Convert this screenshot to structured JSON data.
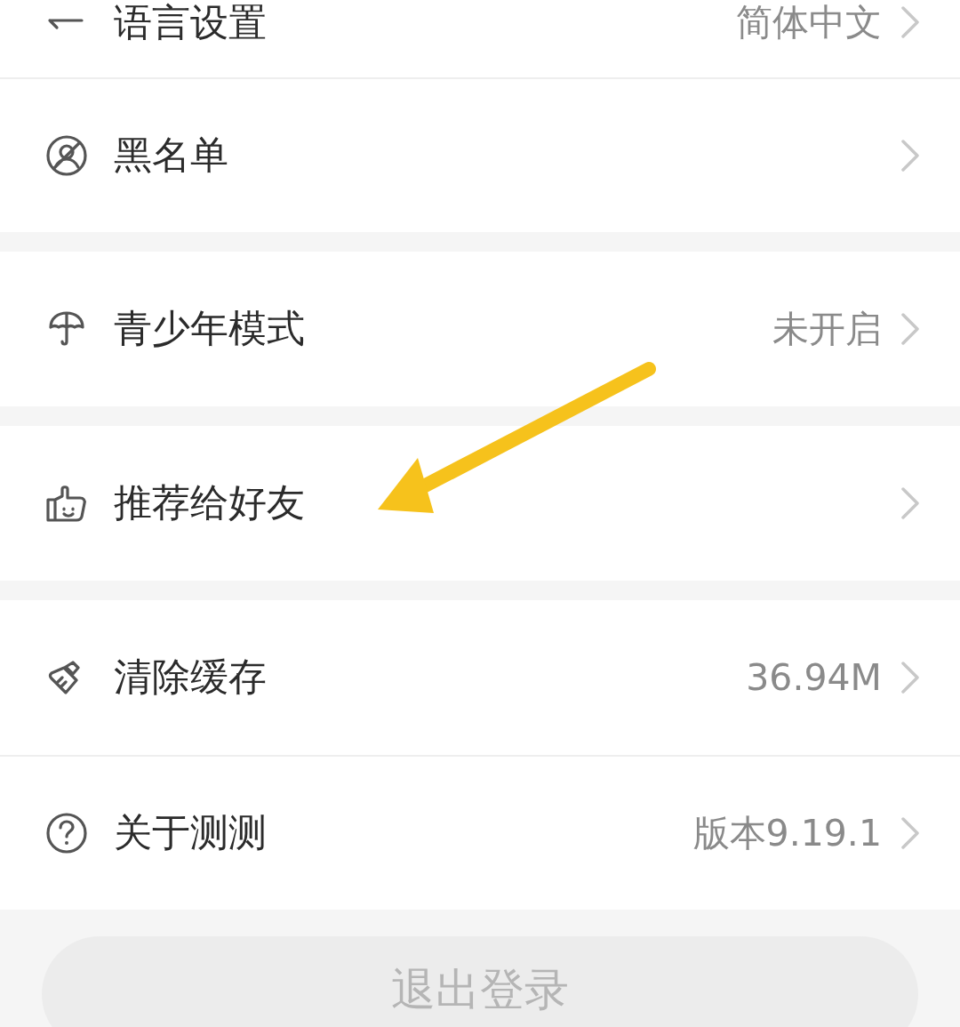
{
  "groups": [
    {
      "items": [
        {
          "label": "语言设置",
          "value": "简体中文"
        },
        {
          "label": "黑名单"
        }
      ]
    },
    {
      "items": [
        {
          "label": "青少年模式",
          "value": "未开启"
        }
      ]
    },
    {
      "items": [
        {
          "label": "推荐给好友"
        }
      ]
    },
    {
      "items": [
        {
          "label": "清除缓存",
          "value": "36.94M"
        },
        {
          "label": "关于测测",
          "value": "版本9.19.1"
        }
      ]
    }
  ],
  "logout": {
    "label": "退出登录"
  }
}
